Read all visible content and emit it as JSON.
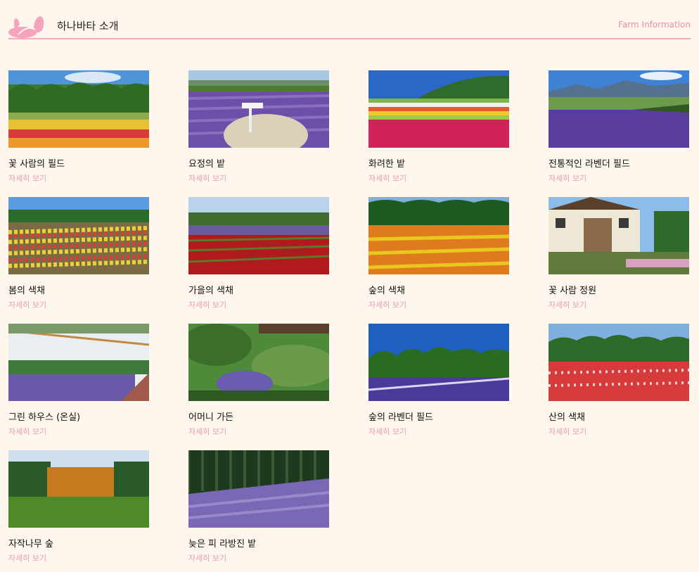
{
  "header": {
    "title": "하나바타 소개",
    "subtitle": "Farm Information",
    "logo_icon": "rabbit-ears-icon",
    "accent": "#f6a9bd"
  },
  "cards": [
    {
      "title": "꽃 사람의 필드",
      "link": "자세히 보기",
      "scene": "tricolor-field"
    },
    {
      "title": "요정의 밭",
      "link": "자세히 보기",
      "scene": "lavender-fairy"
    },
    {
      "title": "화려한 밭",
      "link": "자세히 보기",
      "scene": "rainbow-stripes"
    },
    {
      "title": "전통적인 라벤더 필드",
      "link": "자세히 보기",
      "scene": "lavender-mountains"
    },
    {
      "title": "봄의 색채",
      "link": "자세히 보기",
      "scene": "spring-rows"
    },
    {
      "title": "가을의 색채",
      "link": "자세히 보기",
      "scene": "autumn-red-rows"
    },
    {
      "title": "숲의 색채",
      "link": "자세히 보기",
      "scene": "forest-orange"
    },
    {
      "title": "꽃 사람 정원",
      "link": "자세히 보기",
      "scene": "garden-house"
    },
    {
      "title": "그린 하우스 (온실)",
      "link": "자세히 보기",
      "scene": "greenhouse"
    },
    {
      "title": "어머니 가든",
      "link": "자세히 보기",
      "scene": "mother-garden"
    },
    {
      "title": "숲의 라벤더 필드",
      "link": "자세히 보기",
      "scene": "forest-lavender"
    },
    {
      "title": "산의 색채",
      "link": "자세히 보기",
      "scene": "mountain-poppies"
    },
    {
      "title": "자작나무 숲",
      "link": "자세히 보기",
      "scene": "birch-forest"
    },
    {
      "title": "늦은 피 라방진 밭",
      "link": "자세히 보기",
      "scene": "late-lavender"
    }
  ]
}
